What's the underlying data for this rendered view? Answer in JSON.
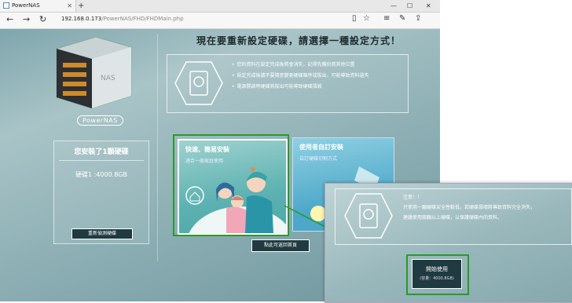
{
  "browser": {
    "tab_title": "PowerNAS",
    "new_tab": "+",
    "url_host": "192.168.0.173",
    "url_path": "/PowerNAS/FHD/FHDMain.php",
    "win_min": "—",
    "win_max": "☐",
    "win_close": "✕"
  },
  "left": {
    "logo_text": "PowerNAS",
    "disk_title": "您安裝了1顆硬碟",
    "disk_info": "硬碟1 :4000.8GB",
    "detect_button": "重新偵測硬碟"
  },
  "main": {
    "heading": "現在要重新設定硬碟，請選擇一種設定方式！",
    "notices": [
      "您的資料在設定完成後將會消失，記得先備份到其他位置",
      "設定完成後請不要隨意變更硬碟順序或拔出，可能導致資料遺失",
      "電源開啟時硬碟將拔出可能導致硬碟損毀"
    ],
    "quick_title": "快速、簡易安裝",
    "quick_sub": "適合一般家庭使用",
    "custom_title": "使用者自訂安裝",
    "custom_sub": "自訂硬碟切割方式",
    "back_button": "點此可返回首頁"
  },
  "zoom": {
    "line1": "注意！！",
    "line2": "只使用一顆硬碟安全性較低，若硬碟損壞將導致資料完全消失，",
    "line3": "建議使用兩顆以上硬碟，以保護硬碟內的資料。",
    "start_label": "開始使用",
    "start_sub": "(容量：4000.8GB)"
  },
  "colors": {
    "highlight": "#2a9a2a",
    "button_bg": "#1f3a40"
  }
}
